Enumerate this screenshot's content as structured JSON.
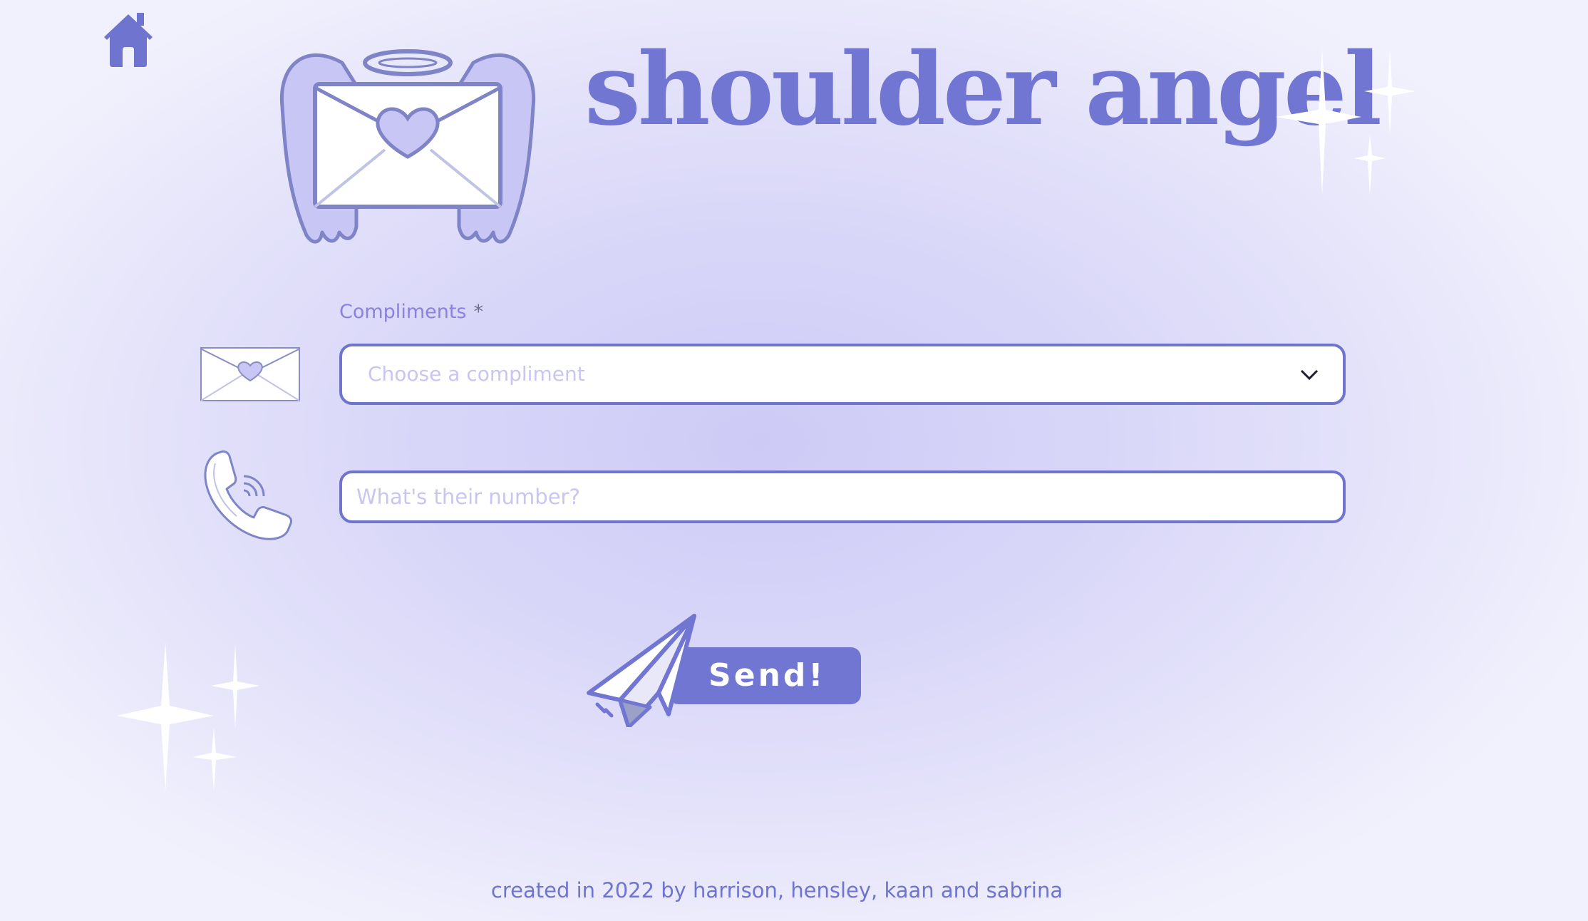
{
  "header": {
    "title": "shoulder angel",
    "home_icon": "home-icon",
    "logo_icon": "angel-envelope-logo"
  },
  "form": {
    "compliments": {
      "label": "Compliments",
      "required_marker": "*",
      "placeholder": "Choose a compliment",
      "icon": "envelope-icon"
    },
    "phone": {
      "placeholder": "What's their number?",
      "icon": "phone-icon"
    },
    "send": {
      "label": "Send!",
      "icon": "paper-plane-icon"
    }
  },
  "footer": {
    "text": "created in 2022 by harrison, hensley, kaan and sabrina"
  },
  "colors": {
    "accent": "#7176d3",
    "label": "#8a82dd",
    "placeholder": "#c9c5f1",
    "background": "#d8d6f8"
  }
}
